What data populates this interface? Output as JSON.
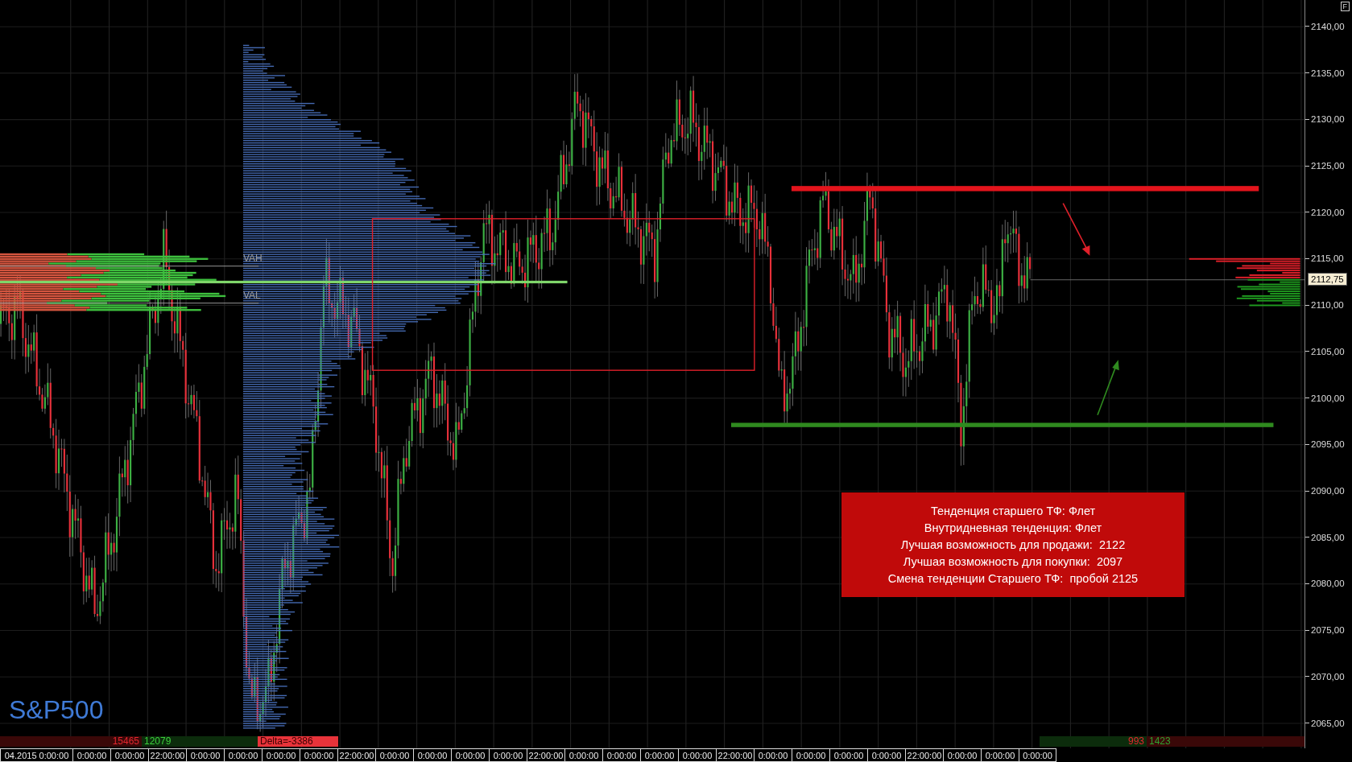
{
  "chart": {
    "instrument": "S&P500",
    "profile_labels": [
      "VAH",
      "VAL"
    ]
  },
  "price_axis": {
    "corner_button": "F",
    "current_price": "2112,75",
    "labels": [
      "2140,00",
      "2135,00",
      "2130,00",
      "2125,00",
      "2120,00",
      "2115,00",
      "2110,00",
      "2105,00",
      "2100,00",
      "2095,00",
      "2090,00",
      "2085,00",
      "2080,00",
      "2075,00",
      "2070,00",
      "2065,00"
    ]
  },
  "time_axis": {
    "labels": [
      "04.2015 0:00:00",
      "0:00:00",
      "0:00:00",
      "22:00:00",
      "0:00:00",
      "0:00:00",
      "0:00:00",
      "0:00:00",
      "22:00:00",
      "0:00:00",
      "0:00:00",
      "0:00:00",
      "0:00:00",
      "22:00:00",
      "0:00:00",
      "0:00:00",
      "0:00:00",
      "0:00:00",
      "22:00:00",
      "0:00:00",
      "0:00:00",
      "0:00:00",
      "0:00:00",
      "22:00:00",
      "0:00:00",
      "0:00:00",
      "0:00:00"
    ]
  },
  "volume_summary": {
    "left": {
      "sell": "15465",
      "buy": "12079",
      "delta": "Delta=-3386"
    },
    "right": {
      "sell": "993",
      "buy": "1423"
    }
  },
  "info_box": {
    "lines": [
      "Тенденция старшего ТФ: Флет",
      "Внутридневная тенденция: Флет",
      "Лучшая возможность для продажи:  2122",
      "Лучшая возможность для покупки:  2097",
      "Смена тенденции Старшего ТФ:  пробой 2125"
    ]
  }
}
